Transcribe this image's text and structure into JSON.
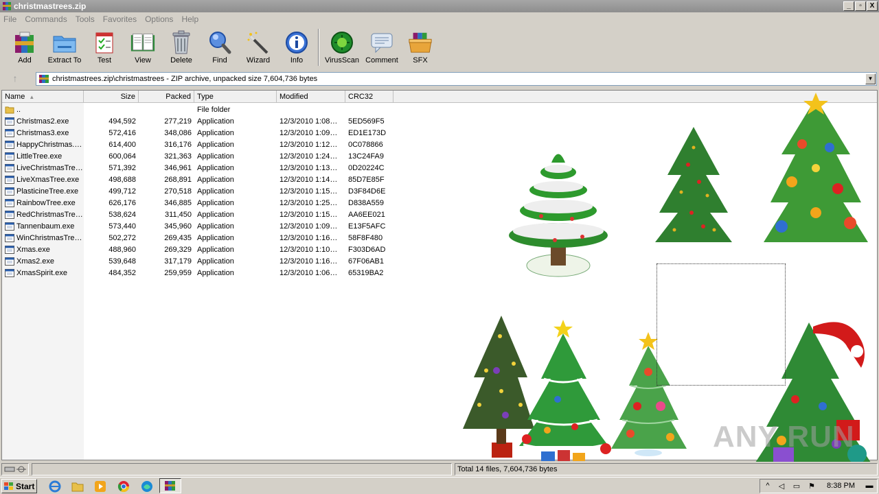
{
  "window": {
    "title": "christmastrees.zip",
    "controls": [
      "_",
      "▫",
      "X"
    ]
  },
  "menu": [
    "File",
    "Commands",
    "Tools",
    "Favorites",
    "Options",
    "Help"
  ],
  "toolbar": [
    {
      "label": "Add",
      "icon": "add-archive-icon"
    },
    {
      "label": "Extract To",
      "icon": "extract-folder-icon"
    },
    {
      "label": "Test",
      "icon": "test-checklist-icon"
    },
    {
      "label": "View",
      "icon": "view-book-icon"
    },
    {
      "label": "Delete",
      "icon": "trash-bin-icon"
    },
    {
      "label": "Find",
      "icon": "magnifier-icon"
    },
    {
      "label": "Wizard",
      "icon": "magic-wand-icon"
    },
    {
      "label": "Info",
      "icon": "info-icon"
    },
    {
      "label": "VirusScan",
      "icon": "virus-scan-icon"
    },
    {
      "label": "Comment",
      "icon": "comment-icon"
    },
    {
      "label": "SFX",
      "icon": "sfx-box-icon"
    }
  ],
  "address": {
    "path": "christmastrees.zip\\christmastrees - ZIP archive, unpacked size 7,604,736 bytes"
  },
  "columns": {
    "name": "Name",
    "size": "Size",
    "packed": "Packed",
    "type": "Type",
    "modified": "Modified",
    "crc": "CRC32"
  },
  "parent_row": {
    "name": "..",
    "type": "File folder"
  },
  "files": [
    {
      "name": "Christmas2.exe",
      "size": "494,592",
      "packed": "277,219",
      "type": "Application",
      "modified": "12/3/2010 1:08…",
      "crc": "5ED569F5"
    },
    {
      "name": "Christmas3.exe",
      "size": "572,416",
      "packed": "348,086",
      "type": "Application",
      "modified": "12/3/2010 1:09…",
      "crc": "ED1E173D"
    },
    {
      "name": "HappyChristmas.…",
      "size": "614,400",
      "packed": "316,176",
      "type": "Application",
      "modified": "12/3/2010 1:12…",
      "crc": "0C078866"
    },
    {
      "name": "LittleTree.exe",
      "size": "600,064",
      "packed": "321,363",
      "type": "Application",
      "modified": "12/3/2010 1:24…",
      "crc": "13C24FA9"
    },
    {
      "name": "LiveChristmasTre…",
      "size": "571,392",
      "packed": "346,961",
      "type": "Application",
      "modified": "12/3/2010 1:13…",
      "crc": "0D20224C"
    },
    {
      "name": "LiveXmasTree.exe",
      "size": "498,688",
      "packed": "268,891",
      "type": "Application",
      "modified": "12/3/2010 1:14…",
      "crc": "85D7E85F"
    },
    {
      "name": "PlasticineTree.exe",
      "size": "499,712",
      "packed": "270,518",
      "type": "Application",
      "modified": "12/3/2010 1:15…",
      "crc": "D3F84D6E"
    },
    {
      "name": "RainbowTree.exe",
      "size": "626,176",
      "packed": "346,885",
      "type": "Application",
      "modified": "12/3/2010 1:25…",
      "crc": "D838A559"
    },
    {
      "name": "RedChristmasTre…",
      "size": "538,624",
      "packed": "311,450",
      "type": "Application",
      "modified": "12/3/2010 1:15…",
      "crc": "AA6EE021"
    },
    {
      "name": "Tannenbaum.exe",
      "size": "573,440",
      "packed": "345,960",
      "type": "Application",
      "modified": "12/3/2010 1:09…",
      "crc": "E13F5AFC"
    },
    {
      "name": "WinChristmasTre…",
      "size": "502,272",
      "packed": "269,435",
      "type": "Application",
      "modified": "12/3/2010 1:16…",
      "crc": "58F8F480"
    },
    {
      "name": "Xmas.exe",
      "size": "488,960",
      "packed": "269,329",
      "type": "Application",
      "modified": "12/3/2010 1:10…",
      "crc": "F303D6AD"
    },
    {
      "name": "Xmas2.exe",
      "size": "539,648",
      "packed": "317,179",
      "type": "Application",
      "modified": "12/3/2010 1:16…",
      "crc": "67F06AB1"
    },
    {
      "name": "XmasSpirit.exe",
      "size": "484,352",
      "packed": "259,959",
      "type": "Application",
      "modified": "12/3/2010 1:06…",
      "crc": "65319BA2"
    }
  ],
  "status": {
    "summary": "Total 14 files, 7,604,736 bytes"
  },
  "watermark": "ANY RUN",
  "taskbar": {
    "start_label": "Start",
    "clock": "8:38 PM"
  }
}
